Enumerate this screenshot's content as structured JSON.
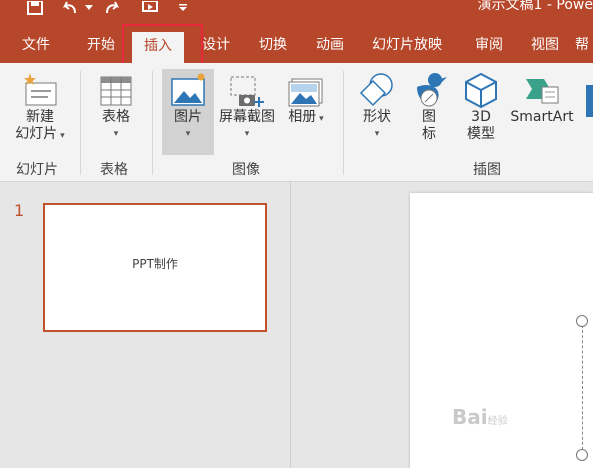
{
  "titlebar": {
    "doc_title": "演示文稿1 - Powe"
  },
  "tabs": [
    "文件",
    "开始",
    "插入",
    "设计",
    "切换",
    "动画",
    "幻灯片放映",
    "审阅",
    "视图",
    "帮"
  ],
  "ribbon": {
    "new_slide": {
      "line1": "新建",
      "line2": "幻灯片"
    },
    "table": {
      "label": "表格"
    },
    "picture": {
      "label": "图片"
    },
    "screenshot": {
      "label": "屏幕截图"
    },
    "album": {
      "label": "相册"
    },
    "shapes": {
      "label": "形状"
    },
    "icons": {
      "line1": "图",
      "line2": "标"
    },
    "model3d": {
      "line1": "3D",
      "line2": "模型"
    },
    "smartart": {
      "label": "SmartArt"
    },
    "groups": [
      "幻灯片",
      "表格",
      "图像",
      "插图"
    ]
  },
  "slides": [
    {
      "number": "1",
      "text": "PPT制作"
    }
  ],
  "watermark": {
    "text": "Bai",
    "suffix": "经验"
  },
  "colors": {
    "accent": "#b7472a",
    "highlight": "#e8283a"
  }
}
